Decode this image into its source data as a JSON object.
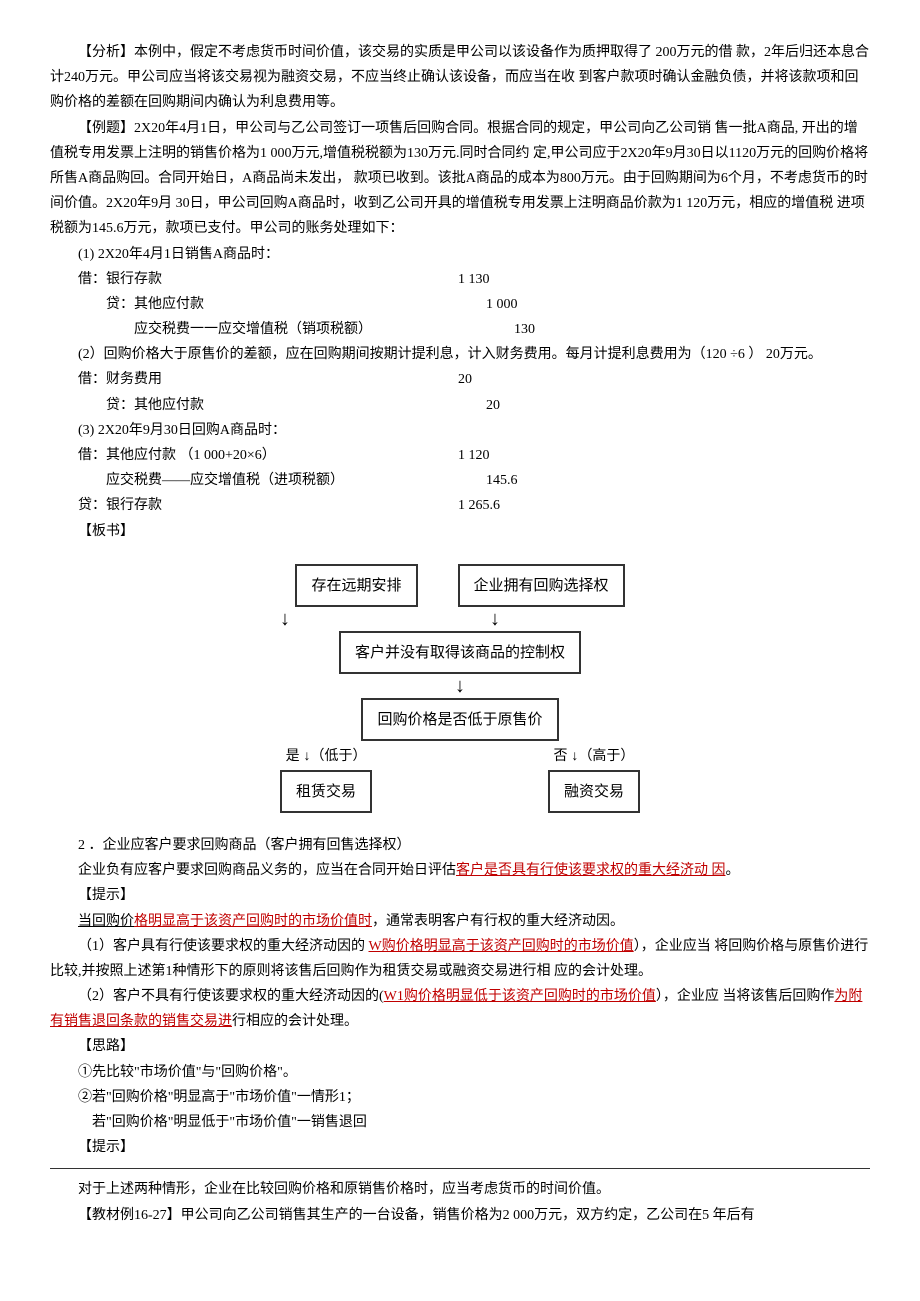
{
  "analysis": {
    "label": "【分析】",
    "text": "本例中，假定不考虑货币时间价值，该交易的实质是甲公司以该设备作为质押取得了 200万元的借 款，2年后归还本息合计240万元。甲公司应当将该交易视为融资交易，不应当终止确认该设备，而应当在收 到客户款项时确认金融负债，并将该款项和回购价格的差额在回购期间内确认为利息费用等。"
  },
  "example": {
    "label": "【例题】",
    "text": "2X20年4月1日，甲公司与乙公司签订一项售后回购合同。根据合同的规定，甲公司向乙公司销 售一批A商品, 开出的增值税专用发票上注明的销售价格为1 000万元,增值税税额为130万元.同时合同约 定,甲公司应于2X20年9月30日以1120万元的回购价格将所售A商品购回。合同开始日，A商品尚未发出，  款项已收到。该批A商品的成本为800万元。由于回购期间为6个月，不考虑货币的时间价值。2X20年9月 30日，甲公司回购A商品时，收到乙公司开具的增值税专用发票上注明商品价款为1 120万元，相应的增值税 进项税额为145.6万元，款项已支付。甲公司的账务处理如下："
  },
  "step1": {
    "title": "(1)  2X20年4月1日销售A商品时：",
    "rows": [
      {
        "label": "借：银行存款",
        "amount": "1 130"
      },
      {
        "label": "贷：其他应付款",
        "amount": "1 000"
      },
      {
        "label": "应交税费一一应交增值税（销项税额）",
        "amount": "130"
      }
    ]
  },
  "step2": {
    "title": "(2）回购价格大于原售价的差额，应在回购期间按期计提利息，计入财务费用。每月计提利息费用为（120 ÷6 ） 20万元。",
    "rows": [
      {
        "label": "借：财务费用",
        "amount": "20"
      },
      {
        "label": "贷：其他应付款",
        "amount": "20"
      }
    ]
  },
  "step3": {
    "title": "(3)       2X20年9月30日回购A商品时：",
    "rows": [
      {
        "label": "借：其他应付款                （1 000+20×6）",
        "amount": "1 120"
      },
      {
        "label": "应交税费——应交增值税（进项税额）",
        "amount": "145.6"
      },
      {
        "label": "贷：银行存款",
        "amount": "1 265.6"
      }
    ]
  },
  "banshu": "【板书】",
  "diagram": {
    "top_left": "存在远期安排",
    "top_right": "企业拥有回购选择权",
    "mid1": "客户并没有取得该商品的控制权",
    "mid2": "回购价格是否低于原售价",
    "yes": "是",
    "yes_note": "（低于）",
    "no": "否",
    "no_note": "（高于）",
    "bottom_left": "租赁交易",
    "bottom_right": "融资交易"
  },
  "section2": {
    "title": "2 ．企业应客户要求回购商品（客户拥有回售选择权）",
    "p1_before": "企业负有应客户要求回购商品义务的，应当在合同开始日评估",
    "p1_red": "客户是否具有行使该要求权的重大经济动 因",
    "p1_after": "。",
    "tip": "【提示】",
    "tip_before": "当回购价",
    "tip_red": "格明显高于该资产回购时的市场价值时",
    "tip_after": "，通常表明客户有行权的重大经济动因。",
    "p2_before": "（1）客户具有行使该要求权的重大经济动因的 ",
    "p2_red": "W购价格明显高于该资产回购时的市场价值",
    "p2_after": "），企业应当 将回购价格与原售价进行比较,并按照上述第1种情形下的原则将该售后回购作为租赁交易或融资交易进行相 应的会计处理。",
    "p3_before": "（2）客户不具有行使该要求权的重大经济动因的(",
    "p3_red1": "W1购价格",
    "p3_mid": "明显低于该资产回购时的市场价值",
    "p3_after1": "），企业应 当将该售后回购作",
    "p3_red2": "为附有销售退回条款的销售交易进",
    "p3_after2": "行相应的会计处理。",
    "silu": "【思路】",
    "silu1": "①先比较\"市场价值\"与\"回购价格\"。",
    "silu2": "②若\"回购价格\"明显高于\"市场价值\"一情形1；",
    "silu3": "若\"回购价格\"明显低于\"市场价值\"一销售退回",
    "tip2": "【提示】",
    "tip2_text": "对于上述两种情形，企业在比较回购价格和原销售价格时，应当考虑货币的时间价值。",
    "example2": "【教材例16-27】甲公司向乙公司销售其生产的一台设备，销售价格为2 000万元，双方约定，乙公司在5 年后有"
  }
}
